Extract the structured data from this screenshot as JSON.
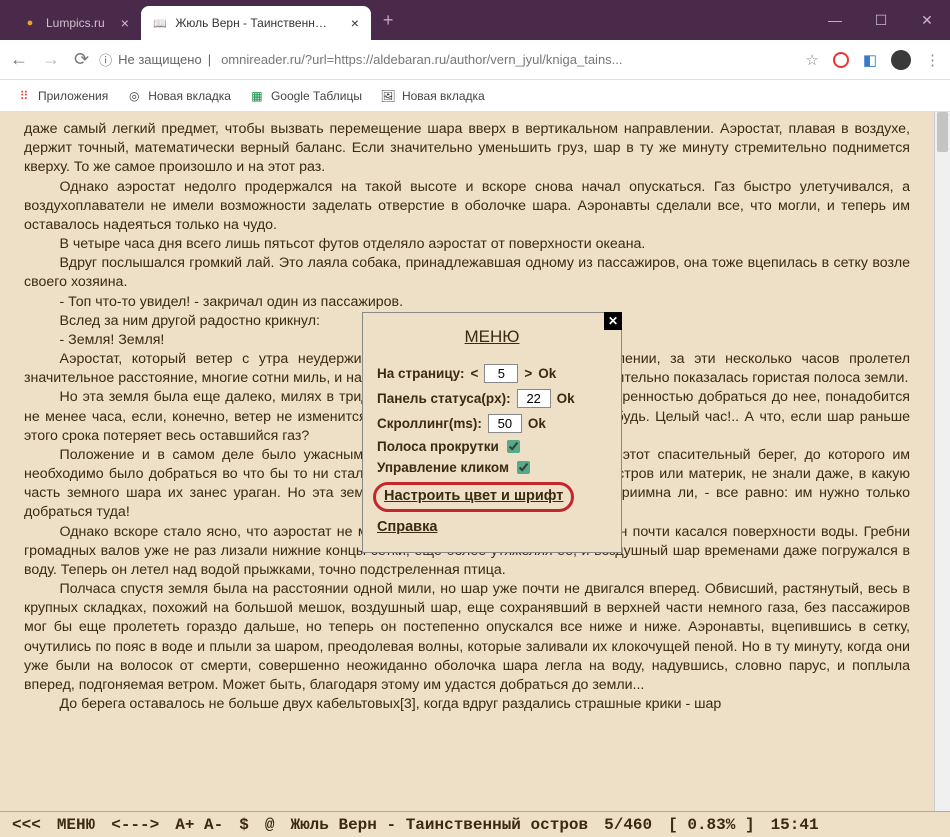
{
  "window": {
    "tabs": [
      {
        "title": "Lumpics.ru",
        "favicon": "●",
        "favcolor": "#f4a020",
        "active": false
      },
      {
        "title": "Жюль Верн - Таинственный ост",
        "favicon": "📖",
        "favcolor": "#888",
        "active": true
      }
    ]
  },
  "addressbar": {
    "secure_label": "Не защищено",
    "url": "omnireader.ru/?url=https://aldebaran.ru/author/vern_jyul/kniga_tains..."
  },
  "bookmarks": [
    {
      "icon": "⠿",
      "color": "#d44",
      "label": "Приложения"
    },
    {
      "icon": "◎",
      "color": "#888",
      "label": "Новая вкладка"
    },
    {
      "icon": "▦",
      "color": "#0a8a3c",
      "label": "Google Таблицы"
    },
    {
      "icon": "🖼",
      "color": "#c8a030",
      "label": "Новая вкладка"
    }
  ],
  "content": {
    "p1": "даже самый легкий предмет, чтобы вызвать перемещение шара вверх в вертикальном направлении. Аэростат, плавая в воздухе, держит точный, математически верный баланс. Если значительно уменьшить груз, шар в ту же минуту стремительно поднимется кверху. То же самое произошло и на этот раз.",
    "p2": "Однако аэростат недолго продержался на такой высоте и вскоре снова начал опускаться. Газ быстро улетучивался, а воздухоплаватели не имели возможности заделать отверстие в оболочке шара. Аэронавты сделали все, что могли, и теперь им оставалось надеяться только на чудо.",
    "p3": "В четыре часа дня всего лишь пятьсот футов отделяло аэростат от поверхности океана.",
    "p4": "Вдруг послышался громкий лай. Это лаяла собака, принадлежавшая одному из пассажиров, она тоже вцепилась в сетку возле своего хозяина.",
    "p5": "- Топ что-то увидел! - закричал один из пассажиров.",
    "p6": "Вслед за ним другой радостно крикнул:",
    "p7": "- Земля! Земля!",
    "p8": "Аэростат, который ветер с утра неудержимо увлекал в юго-западном направлении, за эти несколько часов пролетел значительное расстояние, многие сотни миль, и на горизонте в этом направлении действительно показалась гористая полоса земли.",
    "p9": "Но эта земля была еще далеко, милях в тридцати под ветром. Чтобы с полной уверенностью добраться до нее, понадобится не менее часа, если, конечно, ветер не изменится и шар не отнесет в сторону куда-нибудь. Целый час!.. А что, если шар раньше этого срока потеряет весь оставшийся газ?",
    "p10": "Положение и в самом деле было ужасным. Аэронавты ясно видели ту землю, этот спасительный берег, до которого им необходимо было добраться во что бы то ни стало. Они не знали, что это за земля - остров или материк, не знали даже, в какую часть земного шара их занес ураган. Но эта земля, а обитаема она или нет и гостеприимна ли, - все равно: им нужно только добраться туда!",
    "p11": "Однако вскоре стало ясно, что аэростат не может больше держаться в воздухе. Он почти касался поверхности воды. Гребни громадных валов уже не раз лизали нижние концы сетки, еще более утяжеляя ее, и воздушный шар временами даже погружался в воду. Теперь он летел над водой прыжками, точно подстреленная птица.",
    "p12": "Полчаса спустя земля была на расстоянии одной мили, но шар уже почти не двигался вперед. Обвисший, растянутый, весь в крупных складках, похожий на большой мешок, воздушный шар, еще сохранявший в верхней части немного газа, без пассажиров мог бы еще пролететь гораздо дальше, но теперь он постепенно опускался все ниже и ниже. Аэронавты, вцепившись в сетку, очутились по пояс в воде и плыли за шаром, преодолевая волны, которые заливали их клокочущей пеной. Но в ту минуту, когда они уже были на волосок от смерти, совершенно неожиданно оболочка шара легла на воду, надувшись, словно парус, и поплыла вперед, подгоняемая ветром. Может быть, благодаря этому им удастся добраться до земли...",
    "p13": "До берега оставалось не больше двух кабельтовых[3], когда вдруг раздались страшные крики - шар"
  },
  "menu": {
    "title": "МЕНЮ",
    "rows": {
      "page": {
        "label": "На страницу:",
        "value": "5",
        "ok": "Ok"
      },
      "status": {
        "label": "Панель статуса(px):",
        "value": "22",
        "ok": "Ok"
      },
      "scroll": {
        "label": "Скроллинг(ms):",
        "value": "50",
        "ok": "Ok"
      }
    },
    "checks": {
      "scrollbar": "Полоса прокрутки",
      "click": "Управление кликом"
    },
    "links": {
      "colors": "Настроить цвет и шрифт",
      "help": "Справка"
    }
  },
  "statusbar": {
    "left": "<<<",
    "menu": "МЕНЮ",
    "arrows": "<--->",
    "font": "A+ A-",
    "dollar": "$",
    "at": "@",
    "title": "Жюль Верн - Таинственный остров",
    "page": "5/460",
    "percent": "[ 0.83% ]",
    "time": "15:41"
  }
}
